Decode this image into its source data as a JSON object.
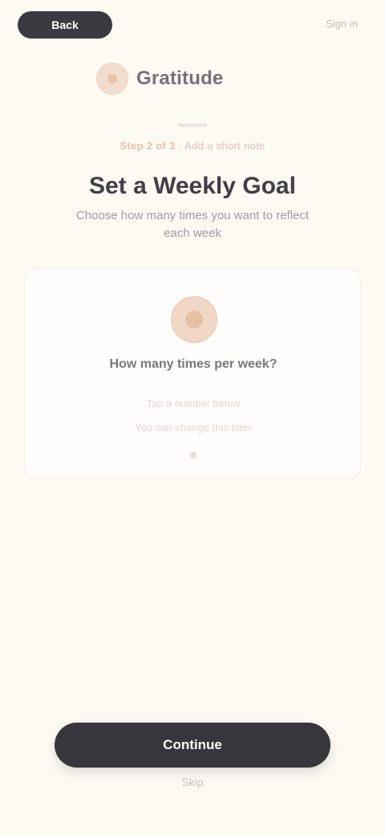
{
  "topbar": {
    "back_label": "Back",
    "right_link": "Sign in"
  },
  "brand": {
    "name": "Gratitude",
    "icon": "badge-icon"
  },
  "hero": {
    "eyebrow_accent": "Step 2 of 3",
    "eyebrow_rest": " · Add a short note",
    "headline": "Set a Weekly Goal",
    "subtitle": "Choose how many times you want to reflect each week"
  },
  "card": {
    "icon": "target-icon",
    "title": "How many times per week?",
    "line_one": "Tap a number below",
    "line_two": "You can change this later"
  },
  "cta": {
    "label": "Continue"
  },
  "footer": {
    "link": "Skip"
  }
}
